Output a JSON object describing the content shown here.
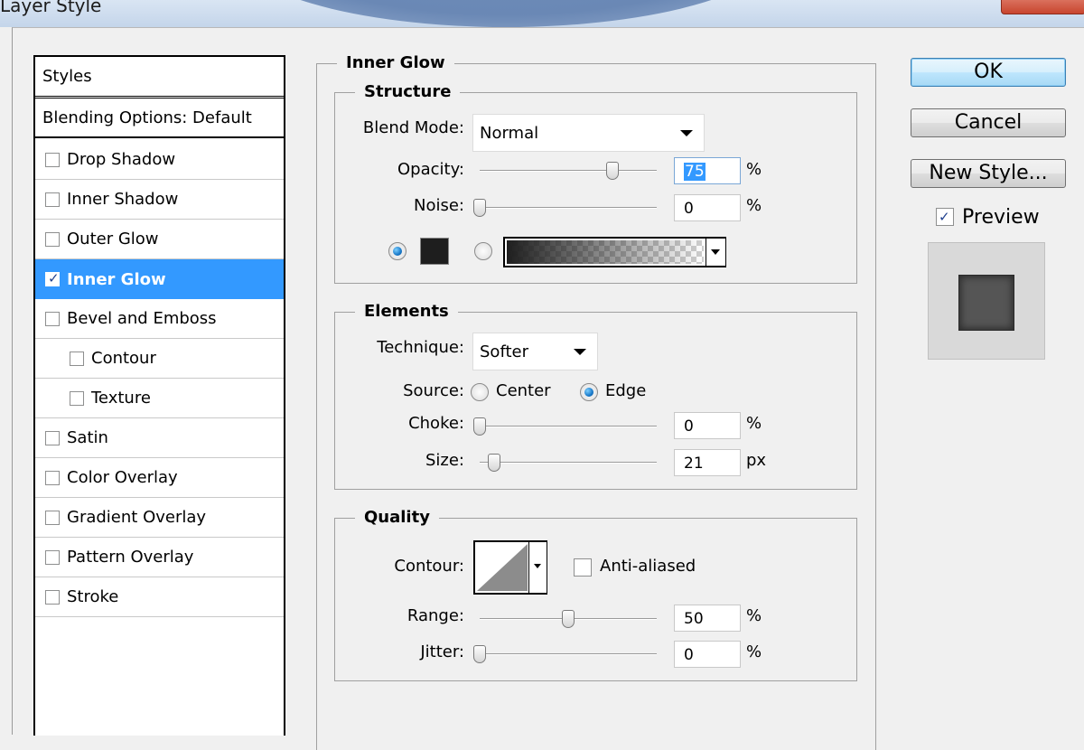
{
  "window": {
    "title": "Layer Style"
  },
  "styles_panel": {
    "header": "Styles",
    "blending_options": "Blending Options: Default",
    "items": [
      {
        "label": "Drop Shadow",
        "checked": false,
        "indent": false,
        "selected": false
      },
      {
        "label": "Inner Shadow",
        "checked": false,
        "indent": false,
        "selected": false
      },
      {
        "label": "Outer Glow",
        "checked": false,
        "indent": false,
        "selected": false
      },
      {
        "label": "Inner Glow",
        "checked": true,
        "indent": false,
        "selected": true
      },
      {
        "label": "Bevel and Emboss",
        "checked": false,
        "indent": false,
        "selected": false
      },
      {
        "label": "Contour",
        "checked": false,
        "indent": true,
        "selected": false
      },
      {
        "label": "Texture",
        "checked": false,
        "indent": true,
        "selected": false
      },
      {
        "label": "Satin",
        "checked": false,
        "indent": false,
        "selected": false
      },
      {
        "label": "Color Overlay",
        "checked": false,
        "indent": false,
        "selected": false
      },
      {
        "label": "Gradient Overlay",
        "checked": false,
        "indent": false,
        "selected": false
      },
      {
        "label": "Pattern Overlay",
        "checked": false,
        "indent": false,
        "selected": false
      },
      {
        "label": "Stroke",
        "checked": false,
        "indent": false,
        "selected": false
      }
    ]
  },
  "inner_glow": {
    "title": "Inner Glow",
    "structure": {
      "title": "Structure",
      "blend_mode_label": "Blend Mode:",
      "blend_mode_value": "Normal",
      "opacity_label": "Opacity:",
      "opacity_value": "75",
      "opacity_unit": "%",
      "noise_label": "Noise:",
      "noise_value": "0",
      "noise_unit": "%",
      "glow_color": "#1e1e1e"
    },
    "elements": {
      "title": "Elements",
      "technique_label": "Technique:",
      "technique_value": "Softer",
      "source_label": "Source:",
      "source_center": "Center",
      "source_edge": "Edge",
      "choke_label": "Choke:",
      "choke_value": "0",
      "choke_unit": "%",
      "size_label": "Size:",
      "size_value": "21",
      "size_unit": "px"
    },
    "quality": {
      "title": "Quality",
      "contour_label": "Contour:",
      "anti_aliased_label": "Anti-aliased",
      "range_label": "Range:",
      "range_value": "50",
      "range_unit": "%",
      "jitter_label": "Jitter:",
      "jitter_value": "0",
      "jitter_unit": "%"
    }
  },
  "buttons": {
    "ok": "OK",
    "cancel": "Cancel",
    "new_style": "New Style...",
    "preview_label": "Preview"
  },
  "colors": {
    "selection": "#3399ff",
    "preview_swatch": "#555555"
  }
}
